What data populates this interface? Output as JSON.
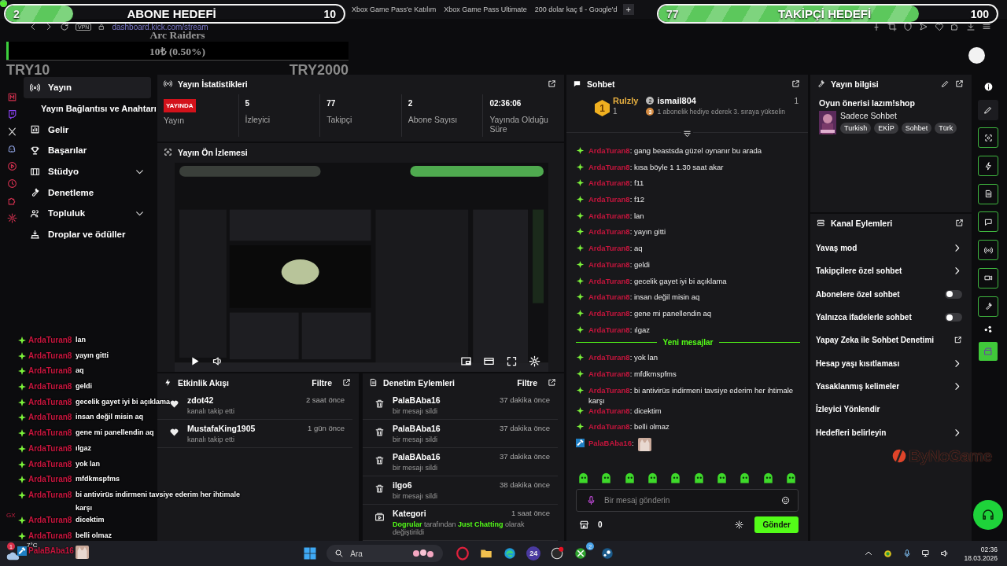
{
  "browser": {
    "tabs": [
      {
        "title": "Xbox Game Pass'e Katılım",
        "selected": false
      },
      {
        "title": "Xbox Game Pass Ultimate",
        "selected": false
      },
      {
        "title": "200 dolar kaç tl - Google'd",
        "selected": false
      }
    ],
    "new_tab": "+",
    "vpn": "VPN",
    "url": "dashboard.kick.com/stream"
  },
  "overlays": {
    "subscriber_goal": {
      "current": "2",
      "title": "ABONE HEDEFİ",
      "target": "10",
      "level": 0.2
    },
    "follower_goal": {
      "current": "77",
      "title": "TAKİPÇİ HEDEFİ",
      "target": "100",
      "level": 0.77
    },
    "donation_goal": {
      "title": "Arc Raiders",
      "amount": "10₺ (0.50%)",
      "level": 0.005,
      "min_label": "TRY10",
      "max_label": "TRY2000"
    },
    "chat": [
      {
        "kind": "sub",
        "user": "ArdaTuran8",
        "text": "lan"
      },
      {
        "kind": "sub",
        "user": "ArdaTuran8",
        "text": "yayın gitti"
      },
      {
        "kind": "sub",
        "user": "ArdaTuran8",
        "text": "aq"
      },
      {
        "kind": "sub",
        "user": "ArdaTuran8",
        "text": "geldi"
      },
      {
        "kind": "sub",
        "user": "ArdaTuran8",
        "text": "gecelik gayet iyi bi açıklama"
      },
      {
        "kind": "sub",
        "user": "ArdaTuran8",
        "text": "insan değil misin aq"
      },
      {
        "kind": "sub",
        "user": "ArdaTuran8",
        "text": "gene mi panellendin aq"
      },
      {
        "kind": "sub",
        "user": "ArdaTuran8",
        "text": "ılgaz"
      },
      {
        "kind": "sub",
        "user": "ArdaTuran8",
        "text": "yok lan"
      },
      {
        "kind": "sub",
        "user": "ArdaTuran8",
        "text": "mfdkmspfms"
      },
      {
        "kind": "sub",
        "user": "ArdaTuran8",
        "text": "bi antivirüs indirmeni tavsiye ederim her ihtimale karşı"
      },
      {
        "kind": "sub",
        "user": "ArdaTuran8",
        "text": "dicektim"
      },
      {
        "kind": "sub",
        "user": "ArdaTuran8",
        "text": "belli olmaz"
      },
      {
        "kind": "mod",
        "user": "PalaBAba16",
        "emote": true
      }
    ],
    "logo": "ByNoGame",
    "gx": "GX"
  },
  "nav": {
    "items": [
      {
        "label": "Yayın",
        "selected": true,
        "children": [
          {
            "label": "Yayın Bağlantısı ve Anahtarı",
            "selected": false
          }
        ]
      },
      {
        "label": "Gelir",
        "selected": false
      },
      {
        "label": "Başarılar",
        "selected": false
      },
      {
        "label": "Stüdyo",
        "selected": false,
        "expanded": false
      },
      {
        "label": "Denetleme",
        "selected": false
      },
      {
        "label": "Topluluk",
        "selected": false,
        "expanded": false
      },
      {
        "label": "Droplar ve ödüller",
        "selected": false
      }
    ]
  },
  "stats": {
    "title": "Yayın İstatistikleri",
    "status": {
      "badge": "YAYINDA",
      "label": "Yayın",
      "live": true
    },
    "metrics": [
      {
        "value": "5",
        "label": "İzleyici"
      },
      {
        "value": "77",
        "label": "Takipçi"
      },
      {
        "value": "2",
        "label": "Abone Sayısı"
      },
      {
        "value": "02:36:06",
        "label": "Yayında Olduğu Süre"
      }
    ]
  },
  "preview": {
    "title": "Yayın Ön İzlemesi"
  },
  "activity": {
    "title": "Etkinlik Akışı",
    "filter": "Filtre",
    "events": [
      {
        "user": "zdot42",
        "action": "kanalı takip etti",
        "time": "2 saat önce"
      },
      {
        "user": "MustafaKing1905",
        "action": "kanalı takip etti",
        "time": "1 gün önce"
      }
    ]
  },
  "moderation": {
    "title": "Denetim Eylemleri",
    "filter": "Filtre",
    "actions": [
      {
        "kind": "delete",
        "user": "PalaBAba16",
        "action": "bir mesajı sildi",
        "time": "37 dakika önce"
      },
      {
        "kind": "delete",
        "user": "PalaBAba16",
        "action": "bir mesajı sildi",
        "time": "37 dakika önce"
      },
      {
        "kind": "delete",
        "user": "PalaBAba16",
        "action": "bir mesajı sildi",
        "time": "37 dakika önce"
      },
      {
        "kind": "delete",
        "user": "ilgo6",
        "action": "bir mesajı sildi",
        "time": "38 dakika önce"
      },
      {
        "kind": "category",
        "user": "Kategori",
        "action": "**Dogrular** tarafından **Just Chatting** olarak değiştirildi",
        "time": "1 saat önce"
      }
    ]
  },
  "chat": {
    "title": "Sohbet",
    "leaderboard": [
      {
        "rank": "1",
        "user": "Rulzly",
        "gifts": "1"
      },
      {
        "rank": "2",
        "user": "ismail804",
        "gifts": "1"
      }
    ],
    "hint": {
      "rank": "3",
      "text": "1 abonelik hediye ederek 3. sıraya yükselin"
    },
    "messages": [
      {
        "kind": "sub",
        "user": "ArdaTuran8",
        "text": ": gang beastsda güzel oynanır bu arada"
      },
      {
        "kind": "sub",
        "user": "ArdaTuran8",
        "text": ": kısa böyle 1 1.30 saat akar"
      },
      {
        "kind": "sub",
        "user": "ArdaTuran8",
        "text": ": f11"
      },
      {
        "kind": "sub",
        "user": "ArdaTuran8",
        "text": ": f12"
      },
      {
        "kind": "sub",
        "user": "ArdaTuran8",
        "text": ": lan"
      },
      {
        "kind": "sub",
        "user": "ArdaTuran8",
        "text": ": yayın gitti"
      },
      {
        "kind": "sub",
        "user": "ArdaTuran8",
        "text": ": aq"
      },
      {
        "kind": "sub",
        "user": "ArdaTuran8",
        "text": ": geldi"
      },
      {
        "kind": "sub",
        "user": "ArdaTuran8",
        "text": ": gecelik gayet iyi bi açıklama"
      },
      {
        "kind": "sub",
        "user": "ArdaTuran8",
        "text": ": insan değil misin aq"
      },
      {
        "kind": "sub",
        "user": "ArdaTuran8",
        "text": ": gene mi panellendin aq"
      },
      {
        "kind": "sub",
        "user": "ArdaTuran8",
        "text": ": ılgaz"
      }
    ],
    "new_divider": "Yeni mesajlar",
    "new_messages": [
      {
        "kind": "sub",
        "user": "ArdaTuran8",
        "text": ": yok lan"
      },
      {
        "kind": "sub",
        "user": "ArdaTuran8",
        "text": ": mfdkmspfms"
      },
      {
        "kind": "sub",
        "user": "ArdaTuran8",
        "text": ": bi antivirüs indirmeni tavsiye ederim her ihtimale karşı"
      },
      {
        "kind": "sub",
        "user": "ArdaTuran8",
        "text": ": dicektim"
      },
      {
        "kind": "sub",
        "user": "ArdaTuran8",
        "text": ": belli olmaz"
      },
      {
        "kind": "mod",
        "user": "PalaBAba16",
        "text": ":",
        "emote": true
      }
    ],
    "input": {
      "placeholder": "Bir mesaj gönderin"
    },
    "points": "0",
    "send": "Gönder"
  },
  "stream_info": {
    "title": "Yayın bilgisi",
    "stream_title": "Oyun önerisi lazım!shop",
    "category": "Sadece Sohbet",
    "tags": [
      "Turkish",
      "EKİP",
      "Sohbet",
      "Türk"
    ]
  },
  "channel_actions": {
    "title": "Kanal Eylemleri",
    "items": [
      {
        "kind": "link",
        "label": "Yavaş mod"
      },
      {
        "kind": "link",
        "label": "Takipçilere özel sohbet"
      },
      {
        "kind": "toggle",
        "label": "Abonelere özel sohbet",
        "on": false
      },
      {
        "kind": "toggle",
        "label": "Yalnızca ifadelerle sohbet",
        "on": false
      },
      {
        "kind": "external",
        "label": "Yapay Zeka ile Sohbet Denetimi"
      },
      {
        "kind": "link",
        "label": "Hesap yaşı kısıtlaması"
      },
      {
        "kind": "link",
        "label": "Yasaklanmış kelimeler"
      },
      {
        "kind": "plain",
        "label": "İzleyici Yönlendir"
      },
      {
        "kind": "link",
        "label": "Hedefleri belirleyin"
      }
    ]
  },
  "taskbar": {
    "weather": {
      "temp": "7°C",
      "badge": "1"
    },
    "search": {
      "placeholder": "Ara"
    },
    "calendar_app": "24",
    "xbox_badge": "2",
    "time": "02:36",
    "date": "18.03.2026"
  }
}
